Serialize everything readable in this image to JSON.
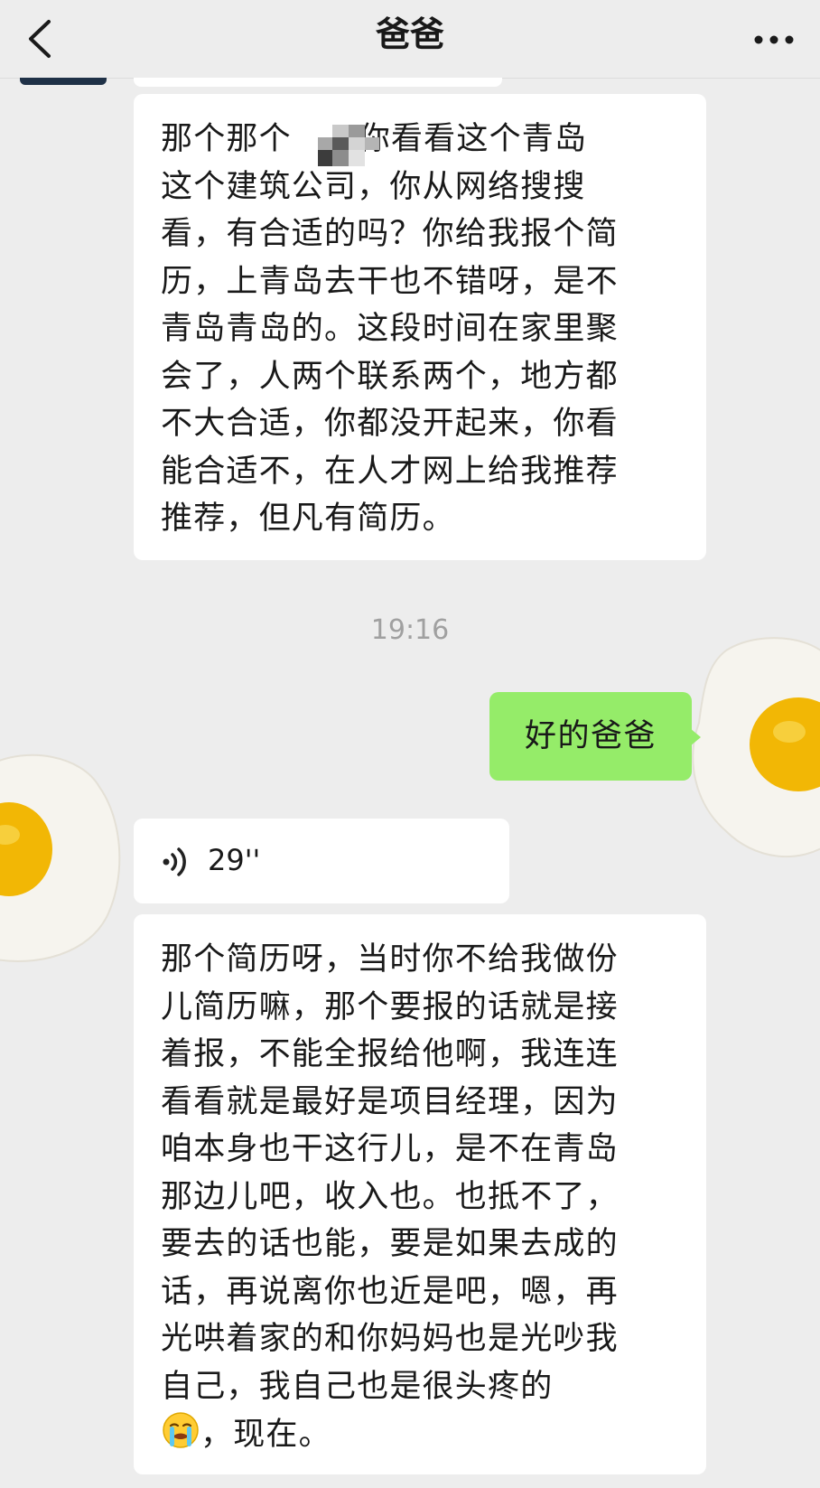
{
  "header": {
    "title": "爸爸"
  },
  "messages": {
    "first_lines": [
      "那个那个",
      "这个建筑公司，你从网络搜搜",
      "看，有合适的吗？你给我报个简",
      "历，上青岛去干也不错呀，是不",
      "青岛青岛的。这段时间在家里聚",
      "会了，人两个联系两个，地方都",
      "不大合适，你都没开起来，你看",
      "能合适不，在人才网上给我推荐",
      "推荐，但凡有简历。"
    ],
    "first_line1_after": "你看看这个青岛",
    "timestamp": "19:16",
    "sent": "好的爸爸",
    "voice_duration": "29''",
    "second_lines": [
      "那个简历呀，当时你不给我做份",
      "儿简历嘛，那个要报的话就是接",
      "着报，不能全报给他啊，我连连",
      "看看就是最好是项目经理，因为",
      "咱本身也干这行儿，是不在青岛",
      "那边儿吧，收入也。也抵不了，",
      "要去的话也能，要是如果去成的",
      "话，再说离你也近是吧，嗯，再",
      "光哄着家的和你妈妈也是光吵我",
      "自己，我自己也是很头疼的"
    ],
    "second_last": "，现在。"
  },
  "colors": {
    "background": "#ededed",
    "sent_bubble": "#95ec69",
    "received_bubble": "#ffffff",
    "timestamp": "#a0a0a0"
  },
  "icons": {
    "back": "chevron-left-icon",
    "more": "more-dots-icon",
    "voice": "voice-wave-icon",
    "cry": "crying-emoji-icon"
  }
}
